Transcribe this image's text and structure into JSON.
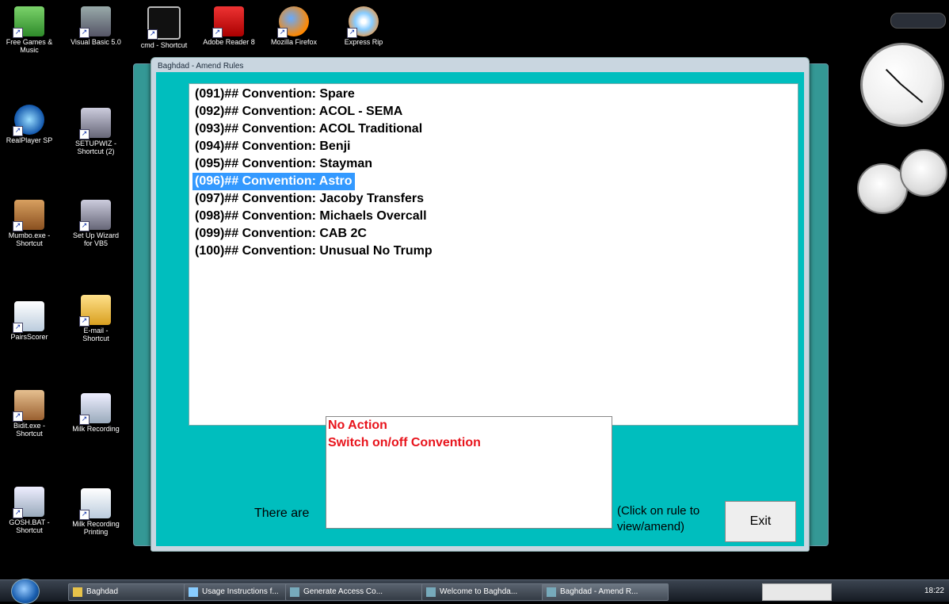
{
  "desktop": {
    "icons": [
      {
        "label": "Free Games & Music"
      },
      {
        "label": "Visual Basic 5.0"
      },
      {
        "label": "cmd - Shortcut"
      },
      {
        "label": "Adobe Reader 8"
      },
      {
        "label": "Mozilla Firefox"
      },
      {
        "label": "Express Rip"
      },
      {
        "label": "RealPlayer SP"
      },
      {
        "label": "SETUPWIZ - Shortcut (2)"
      },
      {
        "label": "Mumbo.exe - Shortcut"
      },
      {
        "label": "Set Up Wizard for VB5"
      },
      {
        "label": "PairsScorer"
      },
      {
        "label": "E-mail - Shortcut"
      },
      {
        "label": "Bidit.exe - Shortcut"
      },
      {
        "label": "Milk Recording"
      },
      {
        "label": "GOSH.BAT - Shortcut"
      },
      {
        "label": "Milk Recording Printing"
      }
    ]
  },
  "dialog": {
    "title": "Baghdad - Amend Rules",
    "rules": [
      "(091)## Convention: Spare",
      "(092)## Convention: ACOL - SEMA",
      "(093)## Convention: ACOL Traditional",
      "(094)## Convention: Benji",
      "(095)## Convention: Stayman",
      "(096)## Convention: Astro",
      "(097)## Convention: Jacoby Transfers",
      "(098)## Convention: Michaels Overcall",
      "(099)## Convention: CAB 2C",
      "(100)## Convention: Unusual No Trump"
    ],
    "selected_index": 5,
    "actions": [
      "No Action",
      "Switch on/off Convention"
    ],
    "count_text": "There are",
    "hint": "(Click on rule to view/amend)",
    "exit_label": "Exit"
  },
  "taskbar": {
    "buttons": [
      "Baghdad",
      "Usage Instructions f...",
      "Generate Access Co...",
      "Welcome to Baghda...",
      "Baghdad - Amend R..."
    ],
    "active_index": 4,
    "clock": "18:22"
  },
  "colors": {
    "dialog_bg": "#00bebe",
    "selection": "#3399ff",
    "action_text": "#e8141c"
  }
}
